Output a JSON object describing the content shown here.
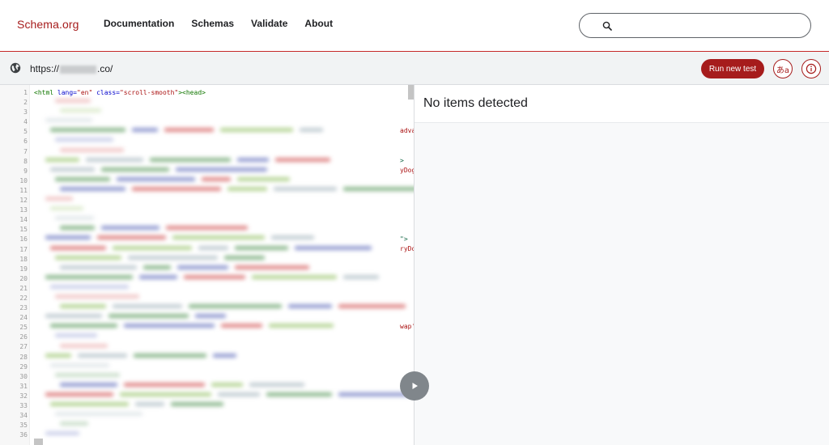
{
  "header": {
    "logo": "Schema.org",
    "nav": [
      "Documentation",
      "Schemas",
      "Validate",
      "About"
    ],
    "search": {
      "value": "",
      "placeholder": ""
    },
    "icons": {
      "search": "search-icon"
    }
  },
  "urlbar": {
    "url_prefix": "https://",
    "url_suffix": ".co/",
    "run_label": "Run new test",
    "lang_label": "あa",
    "info_label": "i",
    "icons": {
      "globe": "globe-icon",
      "info": "info-icon",
      "language": "language-icon"
    },
    "accent": "#a61c1c"
  },
  "code": {
    "first_line": {
      "tag_open": "<html",
      "attr1": " lang=",
      "val1": "\"en\"",
      "attr2": " class=",
      "val2": "\"scroll-smooth\"",
      "tail": "><head>"
    },
    "line_count": 36,
    "edge_fragments": [
      {
        "line": 5,
        "text": "adva"
      },
      {
        "line": 8,
        "text": ">"
      },
      {
        "line": 9,
        "text": "yDog"
      },
      {
        "line": 16,
        "text": "\">"
      },
      {
        "line": 17,
        "text": "ryDo"
      },
      {
        "line": 25,
        "text": "wap'"
      }
    ]
  },
  "results": {
    "title": "No items detected"
  }
}
